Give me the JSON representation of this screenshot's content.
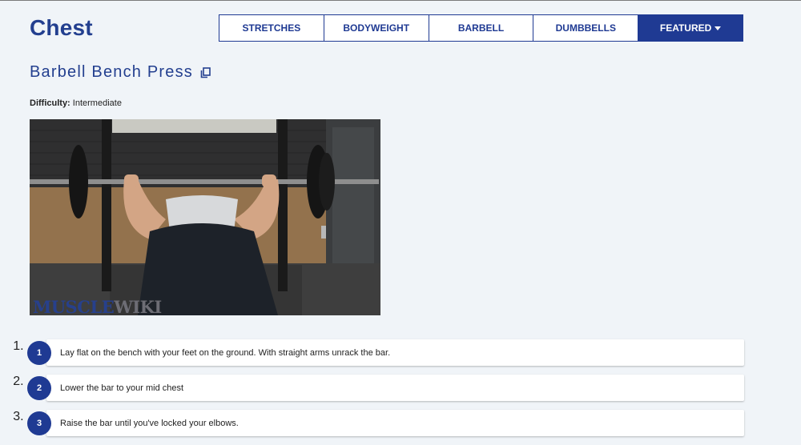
{
  "page": {
    "title": "Chest"
  },
  "tabs": [
    {
      "label": "STRETCHES"
    },
    {
      "label": "BODYWEIGHT"
    },
    {
      "label": "BARBELL"
    },
    {
      "label": "DUMBBELLS"
    },
    {
      "label": "FEATURED"
    }
  ],
  "exercise": {
    "title": "Barbell Bench Press",
    "difficulty_label": "Difficulty:",
    "difficulty_value": "Intermediate",
    "watermark_a": "MUSCLE",
    "watermark_b": "WIKI"
  },
  "steps": [
    {
      "number": "1",
      "text": "Lay flat on the bench with your feet on the ground. With straight arms unrack the bar."
    },
    {
      "number": "2",
      "text": "Lower the bar to your mid chest"
    },
    {
      "number": "3",
      "text": "Raise the bar until you've locked your elbows."
    }
  ],
  "colors": {
    "brand": "#1f3a93",
    "title": "#233f8f",
    "background": "#f0f4f8"
  },
  "icons": {
    "copy": "copy-icon",
    "dropdown": "caret-down-icon"
  }
}
